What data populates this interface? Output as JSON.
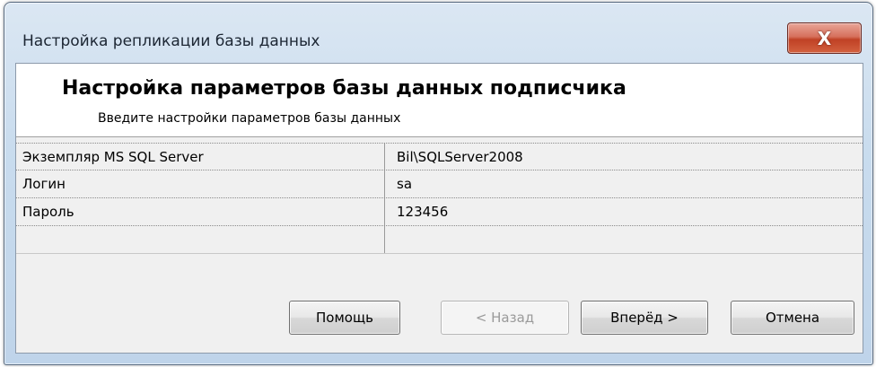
{
  "window": {
    "title": "Настройка репликации базы данных",
    "close_glyph": "X"
  },
  "header": {
    "title": "Настройка параметров базы данных подписчика",
    "subtitle": "Введите настройки параметров базы данных"
  },
  "properties": [
    {
      "name": "Экземпляр MS SQL Server",
      "value": "Bil\\SQLServer2008"
    },
    {
      "name": "Логин",
      "value": "sa"
    },
    {
      "name": "Пароль",
      "value": "123456"
    }
  ],
  "buttons": {
    "help": "Помощь",
    "back": "< Назад",
    "next": "Вперёд >",
    "cancel": "Отмена"
  },
  "colors": {
    "close_button": "#c9492e",
    "frame": "#c9dcee"
  },
  "icons": {
    "close": "close-icon"
  }
}
